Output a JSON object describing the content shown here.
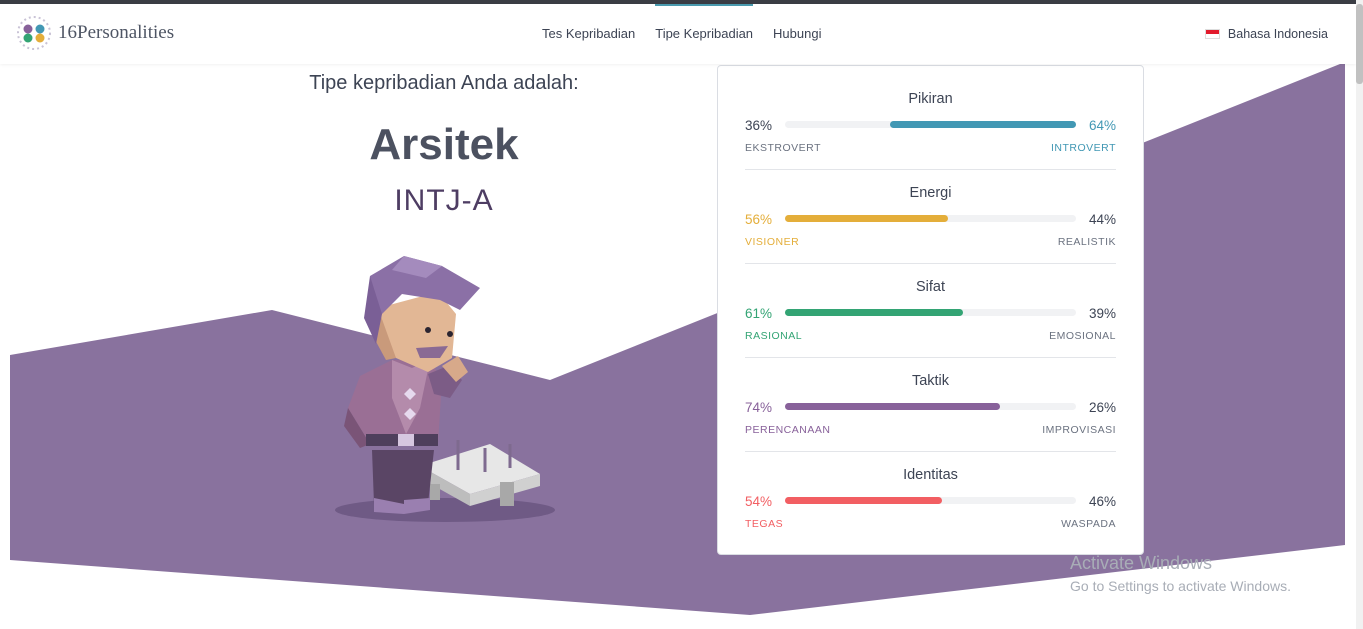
{
  "nav": {
    "brand": "16Personalities",
    "links": [
      {
        "label": "Tes Kepribadian",
        "active": false
      },
      {
        "label": "Tipe Kepribadian",
        "active": true
      },
      {
        "label": "Hubungi",
        "active": false
      }
    ],
    "language": "Bahasa Indonesia"
  },
  "result": {
    "intro": "Tipe kepribadian Anda adalah:",
    "name": "Arsitek",
    "code": "INTJ-A"
  },
  "colors": {
    "purple_bg": "#89729e",
    "mind": "#4298b4",
    "energy": "#e4ae3a",
    "nature": "#33a474",
    "tactics": "#88619a",
    "identity": "#f25e62"
  },
  "traits": [
    {
      "title": "Pikiran",
      "left_pct": "36%",
      "right_pct": "64%",
      "left_label": "EKSTROVERT",
      "right_label": "INTROVERT",
      "fill_from": 0.36,
      "fill_to": 1.0,
      "dominant": "right",
      "color": "#4298b4"
    },
    {
      "title": "Energi",
      "left_pct": "56%",
      "right_pct": "44%",
      "left_label": "VISIONER",
      "right_label": "REALISTIK",
      "fill_from": 0.0,
      "fill_to": 0.56,
      "dominant": "left",
      "color": "#e4ae3a"
    },
    {
      "title": "Sifat",
      "left_pct": "61%",
      "right_pct": "39%",
      "left_label": "RASIONAL",
      "right_label": "EMOSIONAL",
      "fill_from": 0.0,
      "fill_to": 0.61,
      "dominant": "left",
      "color": "#33a474"
    },
    {
      "title": "Taktik",
      "left_pct": "74%",
      "right_pct": "26%",
      "left_label": "PERENCANAAN",
      "right_label": "IMPROVISASI",
      "fill_from": 0.0,
      "fill_to": 0.74,
      "dominant": "left",
      "color": "#88619a"
    },
    {
      "title": "Identitas",
      "left_pct": "54%",
      "right_pct": "46%",
      "left_label": "TEGAS",
      "right_label": "WASPADA",
      "fill_from": 0.0,
      "fill_to": 0.54,
      "dominant": "left",
      "color": "#f25e62"
    }
  ],
  "watermark": {
    "line1": "Activate Windows",
    "line2": "Go to Settings to activate Windows."
  }
}
